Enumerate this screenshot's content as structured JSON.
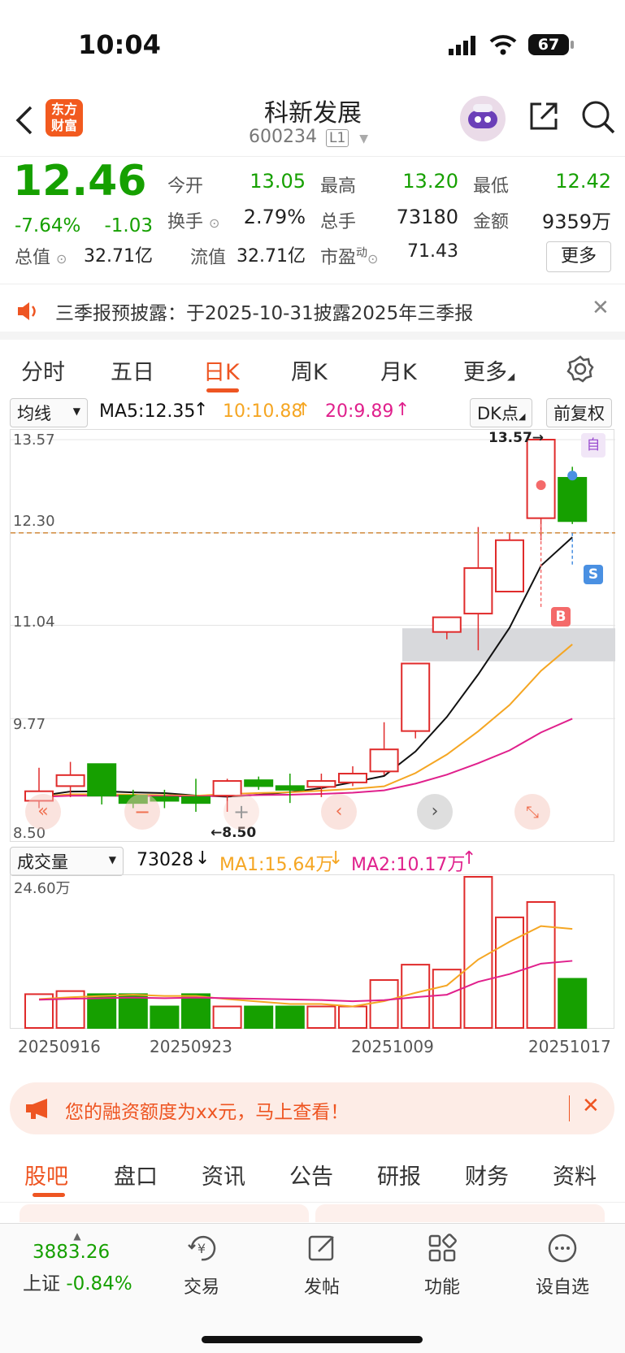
{
  "status": {
    "time": "10:04",
    "battery": "67"
  },
  "header": {
    "logo_line1": "东方",
    "logo_line2": "财富",
    "stock_name": "科新发展",
    "stock_code": "600234",
    "level_badge": "L1",
    "icons": [
      "back-icon",
      "robot-avatar-icon",
      "share-icon",
      "search-icon"
    ]
  },
  "quote": {
    "price": "12.46",
    "change_pct": "-7.64%",
    "change": "-1.03",
    "open_label": "今开",
    "open": "13.05",
    "high_label": "最高",
    "high": "13.20",
    "low_label": "最低",
    "low": "12.42",
    "turnover_label": "换手",
    "turnover": "2.79%",
    "volume_label": "总手",
    "volume": "73180",
    "amount_label": "金额",
    "amount": "9359万",
    "mktcap_label": "总值",
    "mktcap": "32.71亿",
    "float_label": "流值",
    "float_cap": "32.71亿",
    "pe_label": "市盈",
    "pe_sup": "动",
    "pe": "71.43",
    "more_button": "更多"
  },
  "notice": {
    "text": "三季报预披露：于2025-10-31披露2025年三季报"
  },
  "chart_tabs": [
    "分时",
    "五日",
    "日K",
    "周K",
    "月K",
    "更多"
  ],
  "active_chart_tab": "日K",
  "ma_bar": {
    "indicator": "均线",
    "ma5": "MA5:12.35",
    "ma10": "10:10.88",
    "ma20": "20:9.89",
    "dk_button": "DK点",
    "adjust_button": "前复权"
  },
  "kchart": {
    "price_labels": [
      "13.57",
      "12.30",
      "11.04",
      "9.77",
      "8.50"
    ],
    "max_marker": "13.57→",
    "min_marker": "←8.50",
    "self_badge": "自",
    "buy_badge": "B",
    "sell_badge": "S"
  },
  "vol_bar": {
    "indicator": "成交量",
    "vol": "73028",
    "ma1": "MA1:15.64万",
    "ma2": "MA2:10.17万"
  },
  "vchart": {
    "max_label": "24.60万"
  },
  "dates": [
    "20250916",
    "20250923",
    "20251009",
    "20251017"
  ],
  "chart_data": {
    "type": "candlestick",
    "ylim": [
      8.5,
      13.57
    ],
    "candles": [
      {
        "o": 8.65,
        "c": 8.78,
        "h": 9.1,
        "l": 8.55
      },
      {
        "o": 8.85,
        "c": 9.0,
        "h": 9.18,
        "l": 8.7
      },
      {
        "o": 9.15,
        "c": 8.72,
        "h": 9.15,
        "l": 8.6
      },
      {
        "o": 8.72,
        "c": 8.62,
        "h": 8.8,
        "l": 8.55
      },
      {
        "o": 8.7,
        "c": 8.65,
        "h": 8.8,
        "l": 8.55
      },
      {
        "o": 8.7,
        "c": 8.62,
        "h": 8.95,
        "l": 8.5
      },
      {
        "o": 8.72,
        "c": 8.92,
        "h": 8.95,
        "l": 8.5
      },
      {
        "o": 8.93,
        "c": 8.85,
        "h": 8.98,
        "l": 8.8
      },
      {
        "o": 8.85,
        "c": 8.8,
        "h": 9.02,
        "l": 8.62
      },
      {
        "o": 8.84,
        "c": 8.92,
        "h": 9.02,
        "l": 8.7
      },
      {
        "o": 8.9,
        "c": 9.02,
        "h": 9.12,
        "l": 8.85
      },
      {
        "o": 9.05,
        "c": 9.35,
        "h": 9.72,
        "l": 9.0
      },
      {
        "o": 9.6,
        "c": 10.52,
        "h": 10.52,
        "l": 9.5
      },
      {
        "o": 10.95,
        "c": 11.15,
        "h": 11.15,
        "l": 10.85
      },
      {
        "o": 11.2,
        "c": 11.82,
        "h": 12.38,
        "l": 10.7
      },
      {
        "o": 11.5,
        "c": 12.2,
        "h": 12.3,
        "l": 11.5
      },
      {
        "o": 12.5,
        "c": 13.57,
        "h": 13.57,
        "l": 12.2
      },
      {
        "o": 13.05,
        "c": 12.46,
        "h": 13.2,
        "l": 12.42
      }
    ],
    "volumes": [
      5.5,
      6.0,
      5.5,
      5.5,
      3.5,
      5.5,
      3.5,
      3.5,
      3.5,
      3.5,
      3.5,
      7.8,
      10.3,
      9.5,
      24.6,
      18.0,
      20.5,
      8.0
    ],
    "vol_ylim": [
      0,
      24.6
    ],
    "ma_lines": [
      {
        "name": "MA5",
        "color": "#111111"
      },
      {
        "name": "MA10",
        "color": "#f5a623"
      },
      {
        "name": "MA20",
        "color": "#e0208c"
      }
    ]
  },
  "ad": {
    "text": "您的融资额度为xx元，马上查看！"
  },
  "bottom_tabs": [
    "股吧",
    "盘口",
    "资讯",
    "公告",
    "研报",
    "财务",
    "资料"
  ],
  "active_bottom_tab": "股吧",
  "nav": {
    "index_value": "3883.26",
    "index_name": "上证",
    "index_change": "-0.84%",
    "items": [
      "交易",
      "发帖",
      "功能",
      "设自选"
    ]
  },
  "colors": {
    "up": "#e02b2b",
    "down": "#16a000",
    "accent": "#ee6600"
  }
}
